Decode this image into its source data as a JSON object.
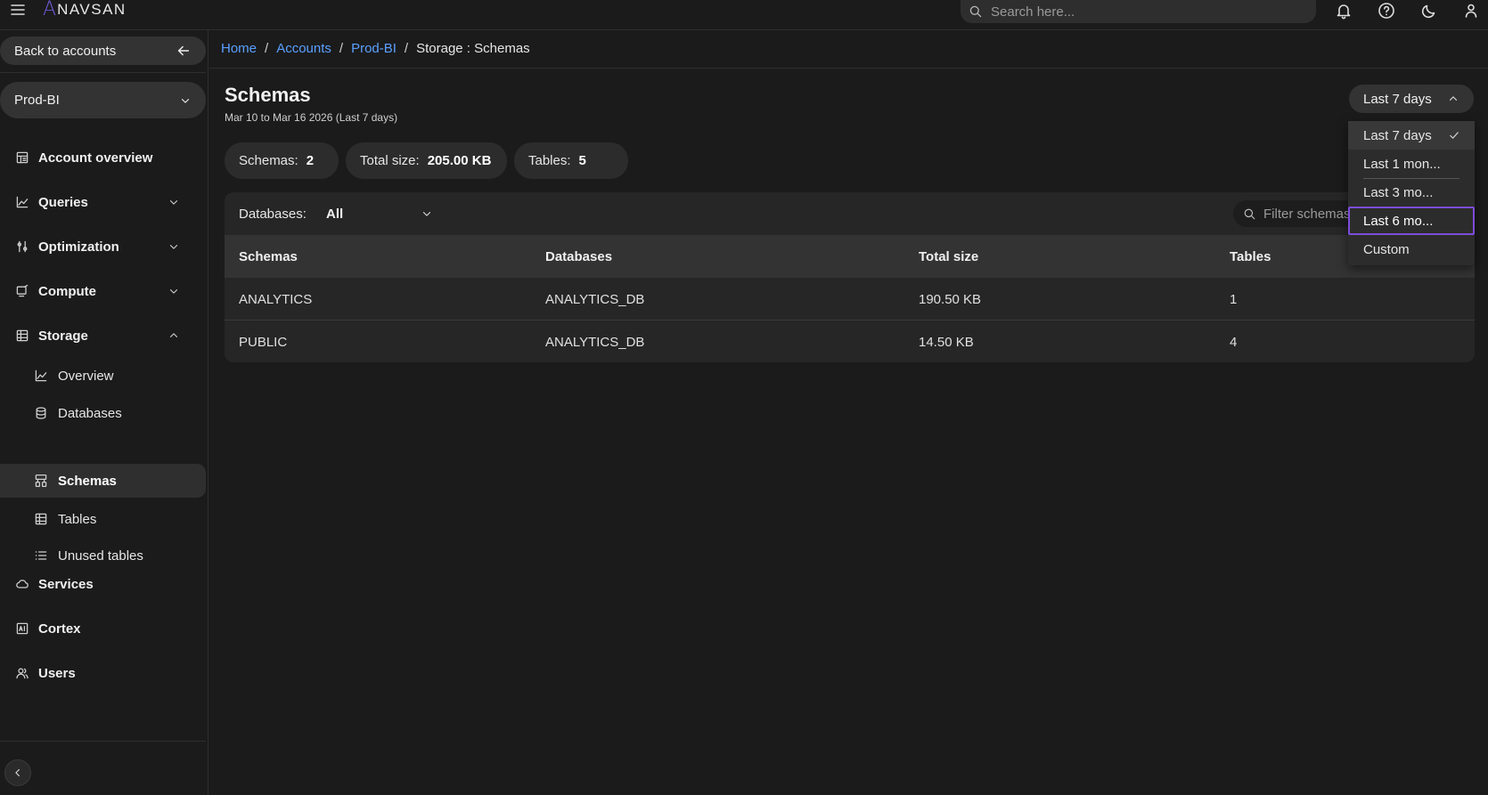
{
  "brand": {
    "logo_letter": "A",
    "logo_text": "NAVSAN",
    "accent": "#6f5bd8"
  },
  "topbar": {
    "search_placeholder": "Search here..."
  },
  "sidebar": {
    "back_label": "Back to accounts",
    "account_selected": "Prod-BI",
    "items": [
      {
        "label": "Account overview"
      },
      {
        "label": "Queries"
      },
      {
        "label": "Optimization"
      },
      {
        "label": "Compute"
      },
      {
        "label": "Storage"
      },
      {
        "label": "Services"
      },
      {
        "label": "Cortex"
      },
      {
        "label": "Users"
      }
    ],
    "storage_sub": [
      {
        "label": "Overview"
      },
      {
        "label": "Databases"
      },
      {
        "label": "Schemas"
      },
      {
        "label": "Tables"
      },
      {
        "label": "Unused tables"
      }
    ]
  },
  "breadcrumb": {
    "home": "Home",
    "accounts": "Accounts",
    "account": "Prod-BI",
    "current": "Storage : Schemas"
  },
  "page": {
    "title": "Schemas",
    "date_range": "Mar 10 to Mar 16 2026 (Last 7 days)",
    "period_selected": "Last 7 days"
  },
  "stats": {
    "schemas_label": "Schemas:",
    "schemas_value": "2",
    "size_label": "Total size:",
    "size_value": "205.00 KB",
    "tables_label": "Tables:",
    "tables_value": "5"
  },
  "filters": {
    "databases_label": "Databases:",
    "databases_value": "All",
    "search_placeholder": "Filter schemas..."
  },
  "table": {
    "headers": [
      "Schemas",
      "Databases",
      "Total size",
      "Tables"
    ],
    "rows": [
      [
        "ANALYTICS",
        "ANALYTICS_DB",
        "190.50 KB",
        "1"
      ],
      [
        "PUBLIC",
        "ANALYTICS_DB",
        "14.50 KB",
        "4"
      ]
    ]
  },
  "period_dropdown": {
    "options": [
      "Last 7 days",
      "Last 1 mon...",
      "Last 3 mo...",
      "Last 6 mo...",
      "Custom"
    ]
  }
}
